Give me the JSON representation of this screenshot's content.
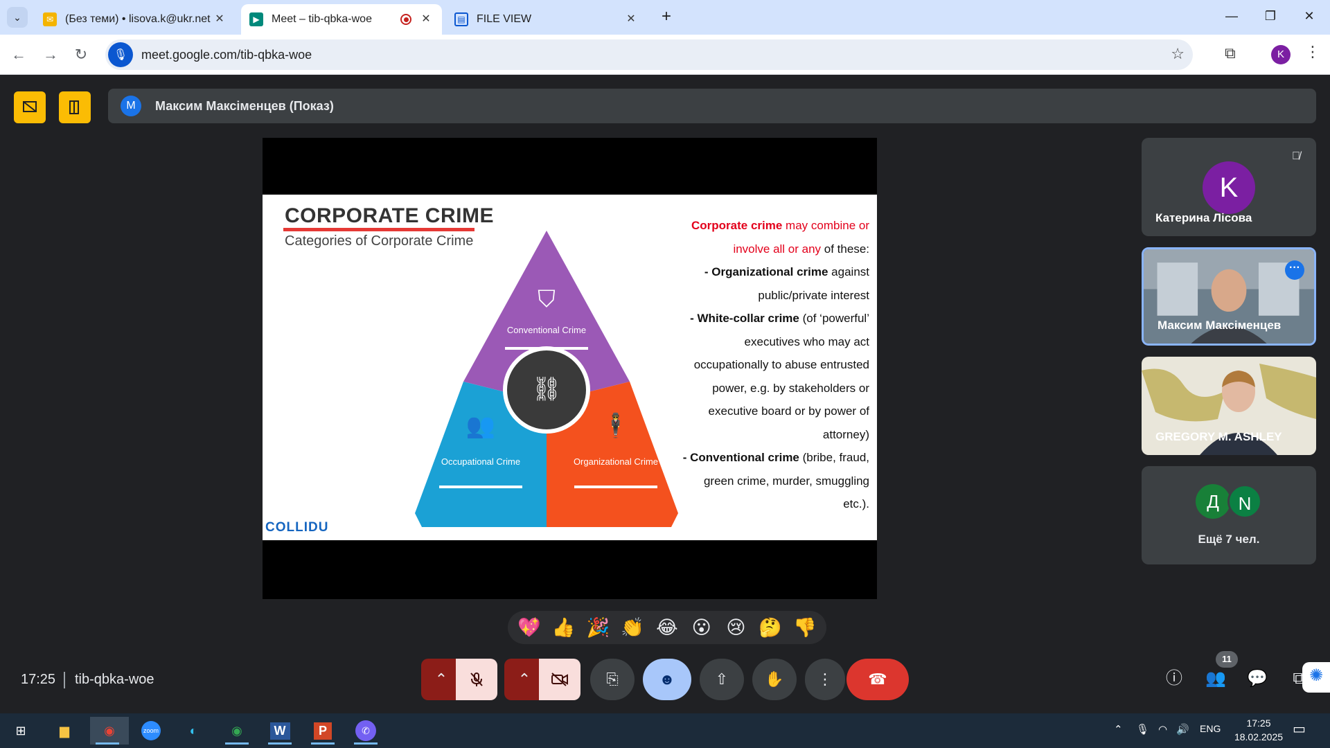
{
  "browser": {
    "tabs": [
      {
        "title": "(Без теми) • lisova.k@ukr.net",
        "close": "✕"
      },
      {
        "title": "Meet – tib-qbka-woe",
        "close": "✕"
      },
      {
        "title": "FILE VIEW",
        "close": "✕"
      }
    ],
    "new_tab": "+",
    "url": "meet.google.com/tib-qbka-woe",
    "profile_initial": "K"
  },
  "meet": {
    "presenter_initial": "M",
    "presenter_label": "Максим Максіменцев (Показ)",
    "slide": {
      "title": "CORPORATE CRIME",
      "subtitle": "Categories of Corporate Crime",
      "segments": [
        "Conventional Crime",
        "Occupational Crime",
        "Organizational Crime"
      ],
      "text_intro_red1": "Corporate crime",
      "text_intro_red2": " may combine or involve all or any",
      "text_intro_rest": " of these:",
      "item1_bold": "- Organizational crime",
      "item1_rest": " against public/private interest",
      "item2_bold": "- White-collar crime",
      "item2_rest": " (of ‘powerful’ executives who may act occupationally to abuse entrusted power, e.g. by stakeholders or executive board or by power of attorney)",
      "item3_bold": "- Conventional crime",
      "item3_rest": " (bribe, fraud, green crime, murder, smuggling etc.).",
      "brand": "COLLIDU"
    },
    "participants": [
      {
        "initial": "K",
        "name": "Катерина Лісова",
        "muted": true
      },
      {
        "name": "Максим Максіменцев"
      },
      {
        "name": "GREGORY M. ASHLEY"
      }
    ],
    "more": {
      "initials": [
        "Д",
        "N"
      ],
      "label": "Ещё 7 чел."
    },
    "reactions": [
      "💖",
      "👍",
      "🎉",
      "👏",
      "😂",
      "😮",
      "😢",
      "🤔",
      "👎"
    ],
    "time": "17:25",
    "meeting_code": "tib-qbka-woe",
    "people_count": "11",
    "colors": {
      "end_call": "#dc362e",
      "accent": "#1a73e8",
      "presenter_yellow": "#fbbc04"
    }
  },
  "taskbar": {
    "language": "ENG",
    "time": "17:25",
    "date": "18.02.2025"
  }
}
